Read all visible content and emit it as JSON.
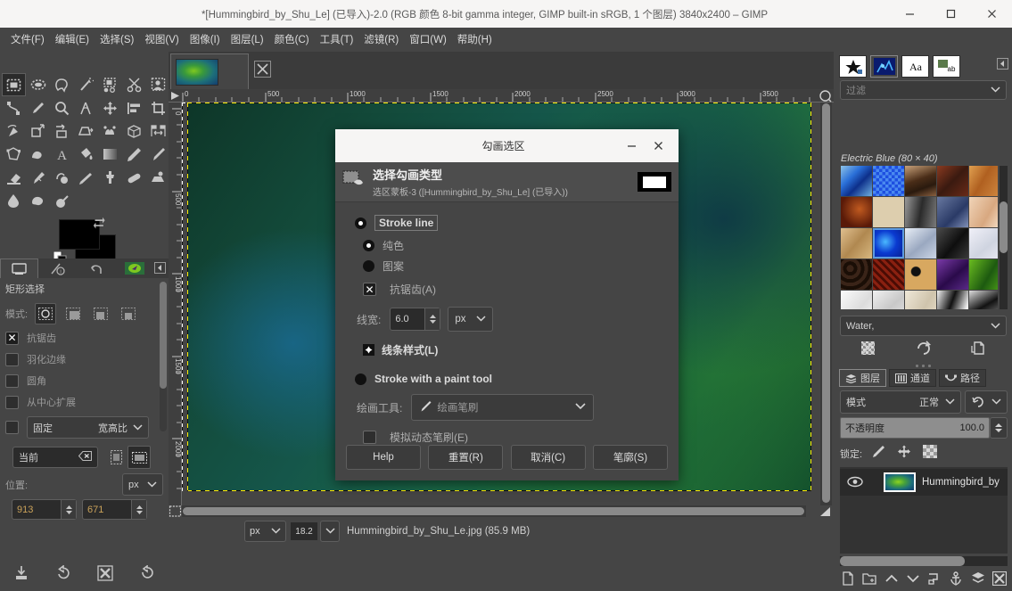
{
  "window": {
    "title": "*[Hummingbird_by_Shu_Le] (已导入)-2.0 (RGB 颜色 8-bit gamma integer, GIMP built-in sRGB, 1 个图层) 3840x2400 – GIMP",
    "minimize": "−",
    "maximize": "□",
    "close": "✕"
  },
  "menubar": {
    "items": [
      {
        "label": "文件(F)"
      },
      {
        "label": "编辑(E)"
      },
      {
        "label": "选择(S)"
      },
      {
        "label": "视图(V)"
      },
      {
        "label": "图像(I)"
      },
      {
        "label": "图层(L)"
      },
      {
        "label": "颜色(C)"
      },
      {
        "label": "工具(T)"
      },
      {
        "label": "滤镜(R)"
      },
      {
        "label": "窗口(W)"
      },
      {
        "label": "帮助(H)"
      }
    ]
  },
  "toolbox": {
    "tools": [
      "rectangle-select-icon",
      "ellipse-select-icon",
      "free-select-icon",
      "fuzzy-select-icon",
      "select-by-color-icon",
      "scissors-select-icon",
      "foreground-select-icon",
      "paths-icon",
      "color-picker-icon",
      "zoom-icon",
      "measure-icon",
      "move-icon",
      "align-icon",
      "crop-icon",
      "rotate-icon",
      "scale-icon",
      "shear-icon",
      "perspective-icon",
      "unified-transform-icon",
      "3d-transform-icon",
      "flip-icon",
      "cage-transform-icon",
      "warp-transform-icon",
      "text-icon",
      "bucket-fill-icon",
      "gradient-icon",
      "pencil-icon",
      "paintbrush-icon",
      "eraser-icon",
      "airbrush-icon",
      "ink-icon",
      "mypaint-brush-icon",
      "clone-icon",
      "heal-icon",
      "perspective-clone-icon",
      "blur-sharpen-icon",
      "smudge-icon",
      "dodge-burn-icon"
    ],
    "selected_tool": "rectangle-select-icon",
    "colors": {
      "foreground": "#000000",
      "background": "#000000",
      "swap_icon": "swap-colors-icon",
      "default_icon": "default-colors-icon"
    },
    "dock_tabs": [
      {
        "name": "tool-options-tab",
        "icon": "tool-options-icon",
        "active": true
      },
      {
        "name": "device-status-tab",
        "icon": "device-status-icon",
        "active": false
      },
      {
        "name": "undo-history-tab",
        "icon": "undo-history-icon",
        "active": false
      },
      {
        "name": "images-tab",
        "icon": "images-thumbnail-icon",
        "active": false
      }
    ],
    "collapse_icon": "collapse-panel-icon"
  },
  "tool_options": {
    "title": "矩形选择",
    "mode_label": "模式:",
    "modes": [
      "replace-selection-icon",
      "add-to-selection-icon",
      "subtract-from-selection-icon",
      "intersect-with-selection-icon"
    ],
    "selected_mode_index": 0,
    "checkboxes": [
      {
        "label": "抗锯齿",
        "checked": true
      },
      {
        "label": "羽化边缘",
        "checked": false
      },
      {
        "label": "圆角",
        "checked": false
      },
      {
        "label": "从中心扩展",
        "checked": false
      },
      {
        "label": "固定",
        "checked": false
      }
    ],
    "fixed_combo_value": "宽高比",
    "aspect_entry_value": "当前",
    "clear_icon": "clear-entry-icon",
    "portrait_icon": "portrait-orientation-icon",
    "landscape_icon": "landscape-orientation-icon",
    "position_label": "位置:",
    "position_unit": "px",
    "position_x": "913",
    "position_y": "671",
    "bottom_buttons": [
      "save-tool-preset-icon",
      "restore-tool-preset-icon",
      "delete-tool-preset-icon",
      "reset-tool-options-icon"
    ]
  },
  "image_window": {
    "tab_thumbnail": "hummingbird-thumbnail",
    "tab_close_icon": "close-tab-icon",
    "ruler_h_ticks": [
      "0",
      "500",
      "1000",
      "1500",
      "2000",
      "2500",
      "3000",
      "3500"
    ],
    "ruler_v_ticks": [
      "0",
      "500",
      "1000",
      "1500",
      "2000"
    ],
    "nav_icon": "navigate-image-icon",
    "quickmask_icon": "quick-mask-icon",
    "statusbar": {
      "unit": "px",
      "zoom": "18.2",
      "zoom_dropdown_icon": "chevron-down-icon",
      "status_text": "Hummingbird_by_Shu_Le.jpg (85.9 MB)"
    }
  },
  "right_dock": {
    "tabs": [
      {
        "name": "brushes-tab",
        "icon": "brushes-icon",
        "active": false
      },
      {
        "name": "patterns-tab",
        "icon": "patterns-icon",
        "active": true
      },
      {
        "name": "fonts-tab",
        "icon": "fonts-icon",
        "active": false
      },
      {
        "name": "document-history-tab",
        "icon": "document-history-icon",
        "active": false
      }
    ],
    "collapse_icon": "collapse-panel-icon",
    "filter_placeholder": "过滤",
    "pattern_label": "Electric Blue (80 × 40)",
    "pattern_name_combo": "Water,",
    "pattern_buttons": [
      "edit-pattern-icon",
      "refresh-patterns-icon",
      "open-pattern-as-image-icon"
    ],
    "patterns": [
      "#6fa8d8",
      "#2b6ede",
      "#6b4a35",
      "#5a3328",
      "#c07a3a",
      "#8c3a16",
      "#d5c6a4",
      "#6a6a6a",
      "#53617e",
      "#e5c1a8",
      "#cfa878",
      "#0b5fe8",
      "#b9c4d8",
      "#2e2e2e",
      "#d8d8e6",
      "#3a2a20",
      "#7a1d12",
      "#e0c08a",
      "#4a2468",
      "#3f7f1f",
      "#e8e8e8",
      "#d4d4d4",
      "#e0d8c8",
      "#8a8a8a",
      "#3a3a3a",
      "#9aa0a6",
      "#b4503a",
      "#c2883c",
      "#a03c2e",
      "#7b4a9e"
    ],
    "selected_pattern_index": 11
  },
  "layers_panel": {
    "tabs": [
      {
        "label": "图层",
        "icon": "layers-icon",
        "active": true
      },
      {
        "label": "通道",
        "icon": "channels-icon",
        "active": false
      },
      {
        "label": "路径",
        "icon": "paths-icon",
        "active": false
      }
    ],
    "collapse_icon": "collapse-panel-icon",
    "mode_label": "模式",
    "mode_value": "正常",
    "blend_space_icon": "blend-space-icon",
    "opacity_label": "不透明度",
    "opacity_value": "100.0",
    "lock_label": "锁定:",
    "lock_icons": [
      "lock-pixels-icon",
      "lock-position-icon",
      "lock-alpha-icon"
    ],
    "layer": {
      "visible_icon": "eye-icon",
      "name": "Hummingbird_by"
    },
    "bottom_buttons": [
      "new-layer-icon",
      "new-layer-group-icon",
      "raise-layer-icon",
      "lower-layer-icon",
      "duplicate-layer-icon",
      "anchor-layer-icon",
      "merge-down-icon",
      "delete-layer-icon"
    ]
  },
  "dialog": {
    "title": "勾画选区",
    "minimize": "−",
    "close": "✕",
    "header_icon": "stroke-selection-icon",
    "header_title": "选择勾画类型",
    "header_subtitle": "选区蒙板-3 ([Hummingbird_by_Shu_Le] (已导入))",
    "swatch_name": "foreground-color-swatch",
    "option_stroke_line": "Stroke line",
    "option_solid_color": "纯色",
    "option_pattern": "图案",
    "antialias_label": "抗锯齿(A)",
    "antialias_checked": true,
    "line_width_label": "线宽:",
    "line_width_value": "6.0",
    "line_width_unit": "px",
    "line_style_label": "线条样式(L)",
    "option_paint_tool": "Stroke with a paint tool",
    "paint_tool_label": "绘画工具:",
    "paint_tool_value": "绘画笔刷",
    "paint_tool_icon": "paintbrush-icon",
    "emulate_brush_label": "模拟动态笔刷(E)",
    "emulate_brush_checked": false,
    "buttons": {
      "help": "Help",
      "reset": "重置(R)",
      "cancel": "取消(C)",
      "stroke": "笔廓(S)"
    },
    "selected_radio": "stroke_line"
  }
}
